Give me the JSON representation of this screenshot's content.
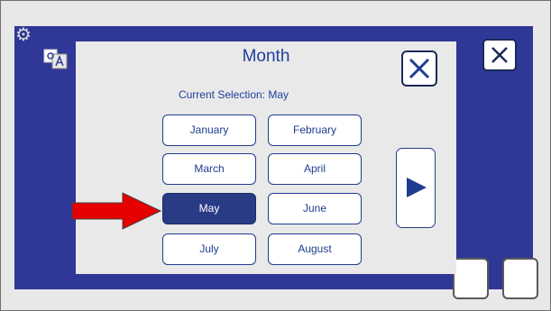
{
  "dialog": {
    "title": "Month",
    "current_selection": "Current Selection: May",
    "selected_month": "May",
    "months": [
      "January",
      "February",
      "March",
      "April",
      "May",
      "June",
      "July",
      "August"
    ]
  },
  "icons": {
    "settings": "gear-icon",
    "language": "translate-icon",
    "dialog_close": "close-icon",
    "outer_close": "close-icon",
    "next_page": "play-right-icon",
    "annotation": "red-arrow-icon"
  },
  "colors": {
    "panel_blue": "#2f3797",
    "dialog_bg": "#e9e9e9",
    "text_blue": "#1f3f9e",
    "selected_bg": "#2a3b86",
    "annotation_red": "#e60000"
  }
}
